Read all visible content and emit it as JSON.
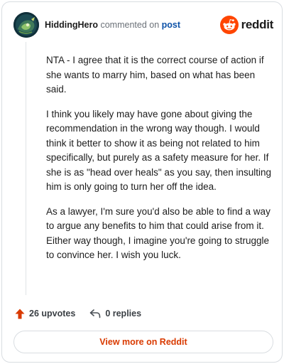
{
  "header": {
    "author": "HiddingHero",
    "verb": "commented on",
    "post_link": "post",
    "brand": "reddit",
    "avatar_icon": "avatar-image",
    "brand_icon": "reddit-snoo-icon"
  },
  "comment": {
    "paragraphs": [
      "NTA - I agree that it is the correct course of action if she wants to marry him, based on what has been said.",
      "I think you likely may have gone about giving the recommendation in the wrong way though. I would think it better to show it as being not related to him specifically, but purely as a safety measure for her. If she is as \"head over heals\" as you say, then insulting him is only going to turn her off the idea.",
      "As a lawyer, I'm sure you'd also be able to find a way to argue any benefits to him that could arise from it. Either way though, I imagine you're going to struggle to convince her. I wish you luck."
    ]
  },
  "actions": {
    "upvotes": "26 upvotes",
    "replies": "0 replies",
    "upvote_icon": "upvote-arrow-icon",
    "reply_icon": "reply-arrow-icon"
  },
  "footer": {
    "view_more": "View more on Reddit"
  },
  "colors": {
    "accent": "#d93a00",
    "upvote": "#d93a00",
    "link": "#0d52a8",
    "brand": "#ff4500"
  }
}
